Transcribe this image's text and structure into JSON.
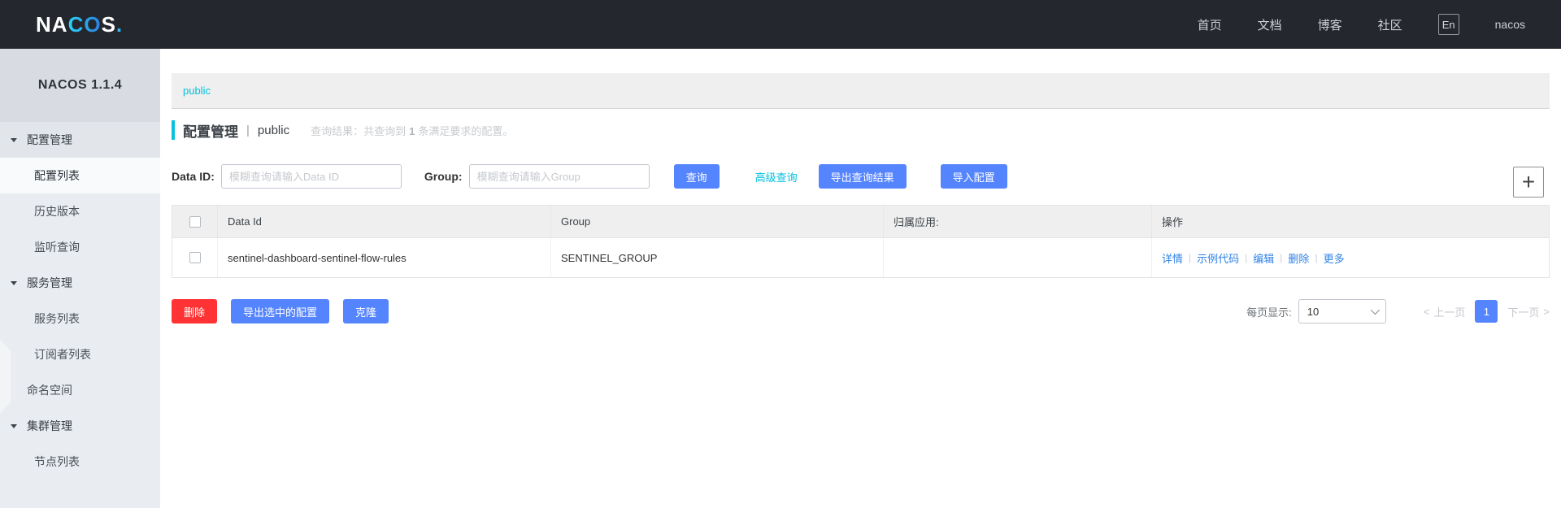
{
  "colors": {
    "primary": "#5584ff",
    "cyan": "#00c1de",
    "danger": "#ff3333",
    "link_blue": "#2e82e8"
  },
  "navbar": {
    "logo": {
      "na": "NA",
      "co": "CO",
      "s": "S",
      "dot": "."
    },
    "links": [
      {
        "label": "首页"
      },
      {
        "label": "文档"
      },
      {
        "label": "博客"
      },
      {
        "label": "社区"
      }
    ],
    "lang": "En",
    "username": "nacos"
  },
  "sidebar": {
    "version": "NACOS 1.1.4",
    "items": [
      {
        "label": "配置管理"
      },
      {
        "label": "配置列表"
      },
      {
        "label": "历史版本"
      },
      {
        "label": "监听查询"
      },
      {
        "label": "服务管理"
      },
      {
        "label": "服务列表"
      },
      {
        "label": "订阅者列表"
      },
      {
        "label": "命名空间"
      },
      {
        "label": "集群管理"
      },
      {
        "label": "节点列表"
      }
    ]
  },
  "main": {
    "namespace_bar": {
      "current": "public"
    },
    "title": {
      "page": "配置管理",
      "separator": "|",
      "namespace": "public",
      "result_prefix": "查询结果：共查询到",
      "result_count": "1",
      "result_suffix": "条满足要求的配置。"
    },
    "form": {
      "data_id_label": "Data ID:",
      "data_id_value": "",
      "data_id_placeholder": "模糊查询请输入Data ID",
      "group_label": "Group:",
      "group_value": "",
      "group_placeholder": "模糊查询请输入Group",
      "search_button": "查询",
      "advanced_link": "高级查询",
      "export_button": "导出查询结果",
      "import_button": "导入配置",
      "add_icon": "+"
    },
    "table": {
      "headers": [
        "Data Id",
        "Group",
        "归属应用:",
        "操作"
      ],
      "action_separator": "|",
      "rows": [
        {
          "data_id": "sentinel-dashboard-sentinel-flow-rules",
          "group": "SENTINEL_GROUP",
          "app": "",
          "actions": [
            "详情",
            "示例代码",
            "编辑",
            "删除",
            "更多"
          ]
        }
      ]
    },
    "batch_actions": {
      "delete": "删除",
      "export_selected": "导出选中的配置",
      "clone": "克隆"
    },
    "pagination": {
      "page_size_label": "每页显示:",
      "page_size": "10",
      "prev_arrow": "<",
      "prev": "上一页",
      "current_page": "1",
      "next": "下一页",
      "next_arrow": ">"
    }
  }
}
